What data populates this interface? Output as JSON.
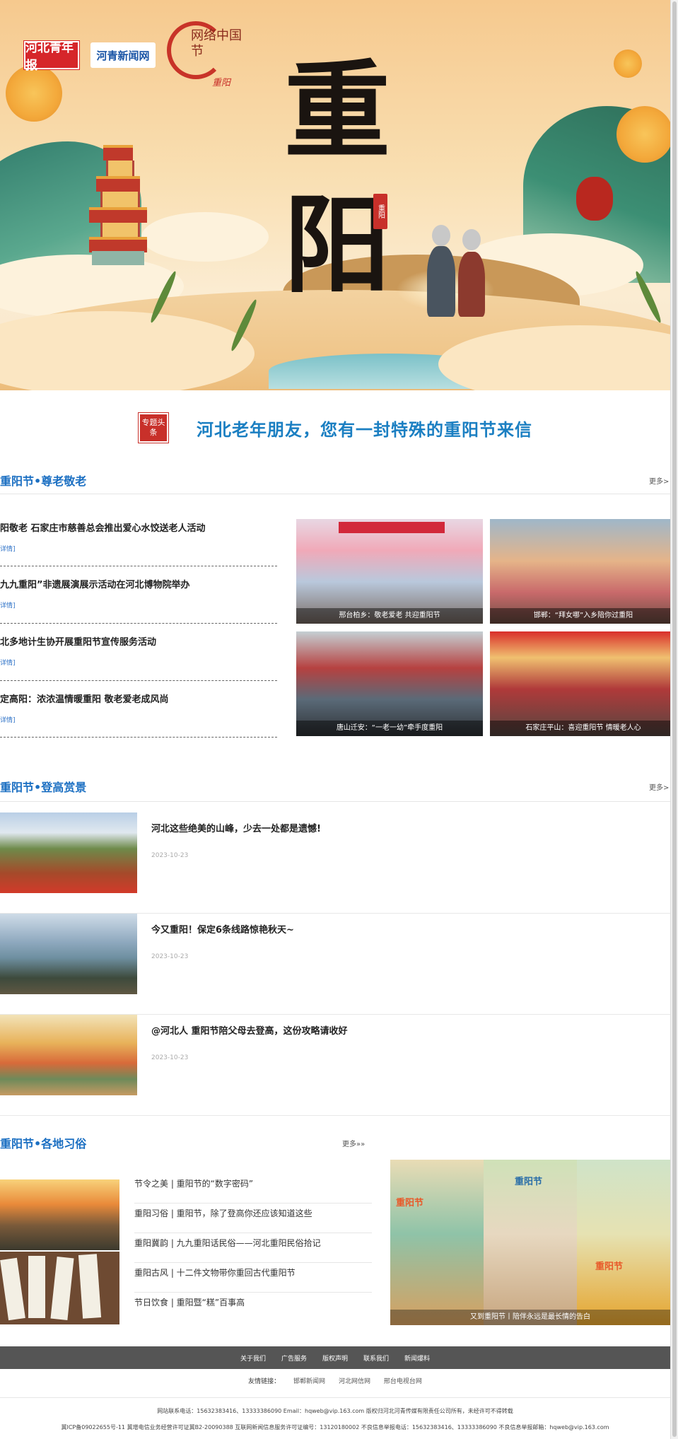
{
  "hero": {
    "logo1": "河北青年报",
    "logo2": "河青新闻网",
    "logo3_main": "网络中国节",
    "logo3_small": "重阳",
    "calligraphy": "重阳",
    "seal": "重阳"
  },
  "headline": {
    "badge": "专题头条",
    "text": "河北老年朋友，您有一封特殊的重阳节来信"
  },
  "section1": {
    "title": "重阳节•尊老敬老",
    "more": "更多>",
    "items": [
      {
        "title": "阳敬老 石家庄市慈善总会推出爱心水饺送老人活动",
        "more": "详情]"
      },
      {
        "title": "九九重阳”非遗展演展示活动在河北博物院举办",
        "more": "详情]"
      },
      {
        "title": "北多地计生协开展重阳节宣传服务活动",
        "more": "详情]"
      },
      {
        "title": "定高阳：浓浓温情暖重阳 敬老爱老成风尚",
        "more": "详情]"
      }
    ],
    "photos": [
      {
        "caption": "邢台柏乡：敬老爱老 共迎重阳节"
      },
      {
        "caption": "邯郸：“拜女哪”入乡陪你过重阳"
      },
      {
        "caption": "唐山迁安：“一老一幼”牵手度重阳"
      },
      {
        "caption": "石家庄平山：喜迎重阳节 情暖老人心"
      }
    ]
  },
  "section2": {
    "title": "重阳节•登高赏景",
    "more": "更多>",
    "items": [
      {
        "title": "河北这些绝美的山峰，少去一处都是遗憾!",
        "date": "2023-10-23"
      },
      {
        "title": "今又重阳！保定6条线路惊艳秋天~",
        "date": "2023-10-23"
      },
      {
        "title": "@河北人 重阳节陪父母去登高，这份攻略请收好",
        "date": "2023-10-23"
      }
    ]
  },
  "section3": {
    "title": "重阳节•各地习俗",
    "more": "更多»»",
    "items": [
      "节令之美 | 重阳节的“数字密码”",
      "重阳习俗 | 重阳节，除了登高你还应该知道这些",
      "重阳冀韵 | 九九重阳话民俗——河北重阳民俗拾记",
      "重阳古风 | 十二件文物带你重回古代重阳节",
      "节日饮食 | 重阳暨“糕”百事高"
    ],
    "poster_caption": "又到重阳节丨陪伴永远是最长情的告白",
    "poster_labels": [
      "重阳节",
      "重阳节",
      "重阳节"
    ]
  },
  "footer": {
    "nav": [
      "关于我们",
      "广告服务",
      "版权声明",
      "联系我们",
      "新闻爆料"
    ],
    "friends_label": "友情链接：",
    "friends": [
      "邯郸新闻网",
      "河北网信网",
      "邢台电视台网"
    ],
    "copy1": "网站联系电话：15632383416、13333386090 Email：hqweb@vip.163.com 版权归河北河青传媒有限责任公司所有，未经许可不得转载",
    "copy2": "冀ICP备09022655号-11 冀增电信业务经营许可证冀B2-20090388 互联网新闻信息服务许可证编号：13120180002 不良信息举报电话：15632383416、13333386090 不良信息举报邮箱：hqweb@vip.163.com"
  }
}
